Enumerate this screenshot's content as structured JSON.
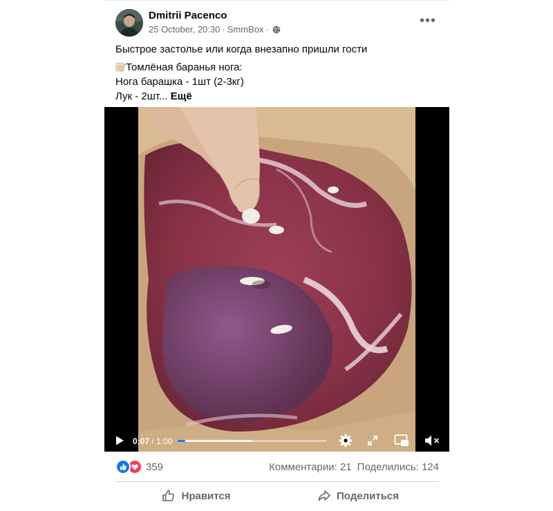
{
  "post": {
    "author": "Dmitrii Pacenco",
    "date": "25 October, 20:30",
    "source": "SmmBox",
    "separator": "·",
    "more_label": "•••",
    "text_line1": "Быстрое застолье или когда внезапно пришли гости",
    "text_line2": "Томлёная баранья нога:",
    "text_line3": "Нога барашка - 1шт (2-3кг)",
    "text_line4_prefix": "Лук - 2шт...",
    "see_more": "Ещё"
  },
  "video": {
    "current_time": "0:07",
    "time_sep": " / ",
    "duration": "1:00",
    "progress": 0.05,
    "buffered": 0.5
  },
  "stats": {
    "reactions_count": "359",
    "comments": "Комментарии: 21",
    "shares": "Поделились: 124"
  },
  "actions": {
    "like": "Нравится",
    "share": "Поделиться"
  },
  "colors": {
    "accent": "#1877f2",
    "love": "#f33e58",
    "secondary_text": "#65676b"
  }
}
